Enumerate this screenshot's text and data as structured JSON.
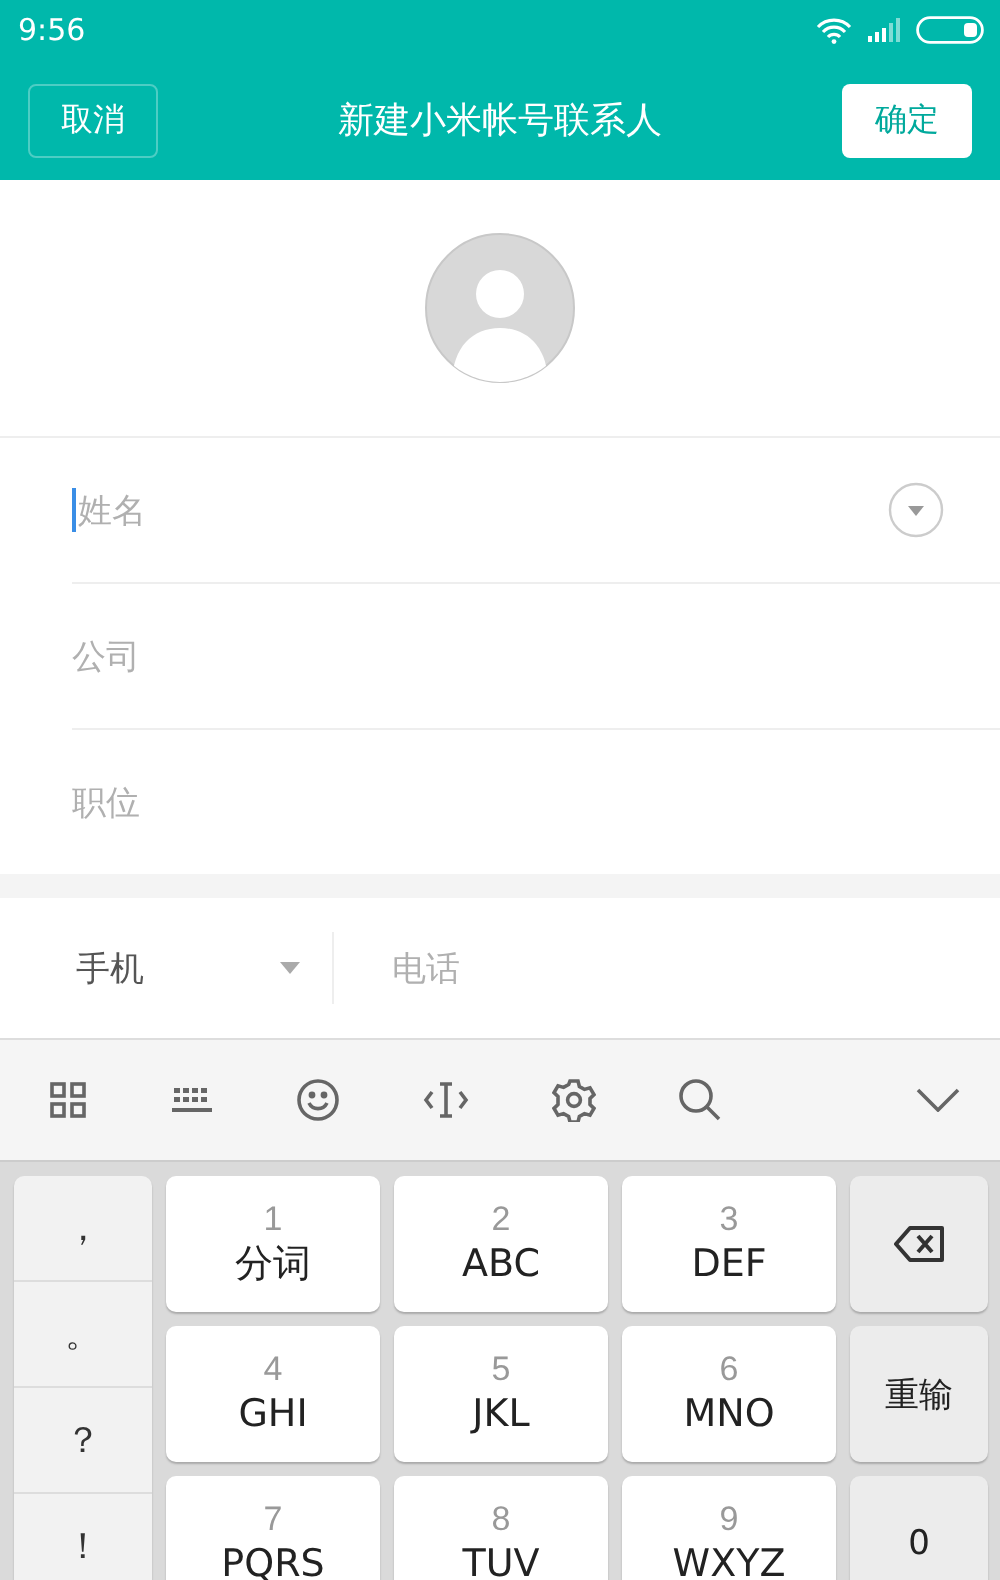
{
  "status_bar": {
    "time": "9:56"
  },
  "header": {
    "cancel": "取消",
    "title": "新建小米帐号联系人",
    "confirm": "确定"
  },
  "fields": [
    {
      "placeholder": "姓名",
      "focused": true,
      "expand": true
    },
    {
      "placeholder": "公司",
      "focused": false,
      "expand": false
    },
    {
      "placeholder": "职位",
      "focused": false,
      "expand": false
    }
  ],
  "phone": {
    "type": "手机",
    "placeholder": "电话"
  },
  "keyboard": {
    "punctuation": [
      "，",
      "。",
      "？",
      "！"
    ],
    "keys": [
      {
        "number": "1",
        "letters": "分词"
      },
      {
        "number": "2",
        "letters": "ABC"
      },
      {
        "number": "3",
        "letters": "DEF"
      },
      {
        "number": "4",
        "letters": "GHI"
      },
      {
        "number": "5",
        "letters": "JKL"
      },
      {
        "number": "6",
        "letters": "MNO"
      },
      {
        "number": "7",
        "letters": "PQRS"
      },
      {
        "number": "8",
        "letters": "TUV"
      },
      {
        "number": "9",
        "letters": "WXYZ"
      }
    ],
    "side_keys": [
      {
        "kind": "delete"
      },
      {
        "kind": "text",
        "label": "重输"
      },
      {
        "kind": "text",
        "label": "0"
      }
    ]
  }
}
